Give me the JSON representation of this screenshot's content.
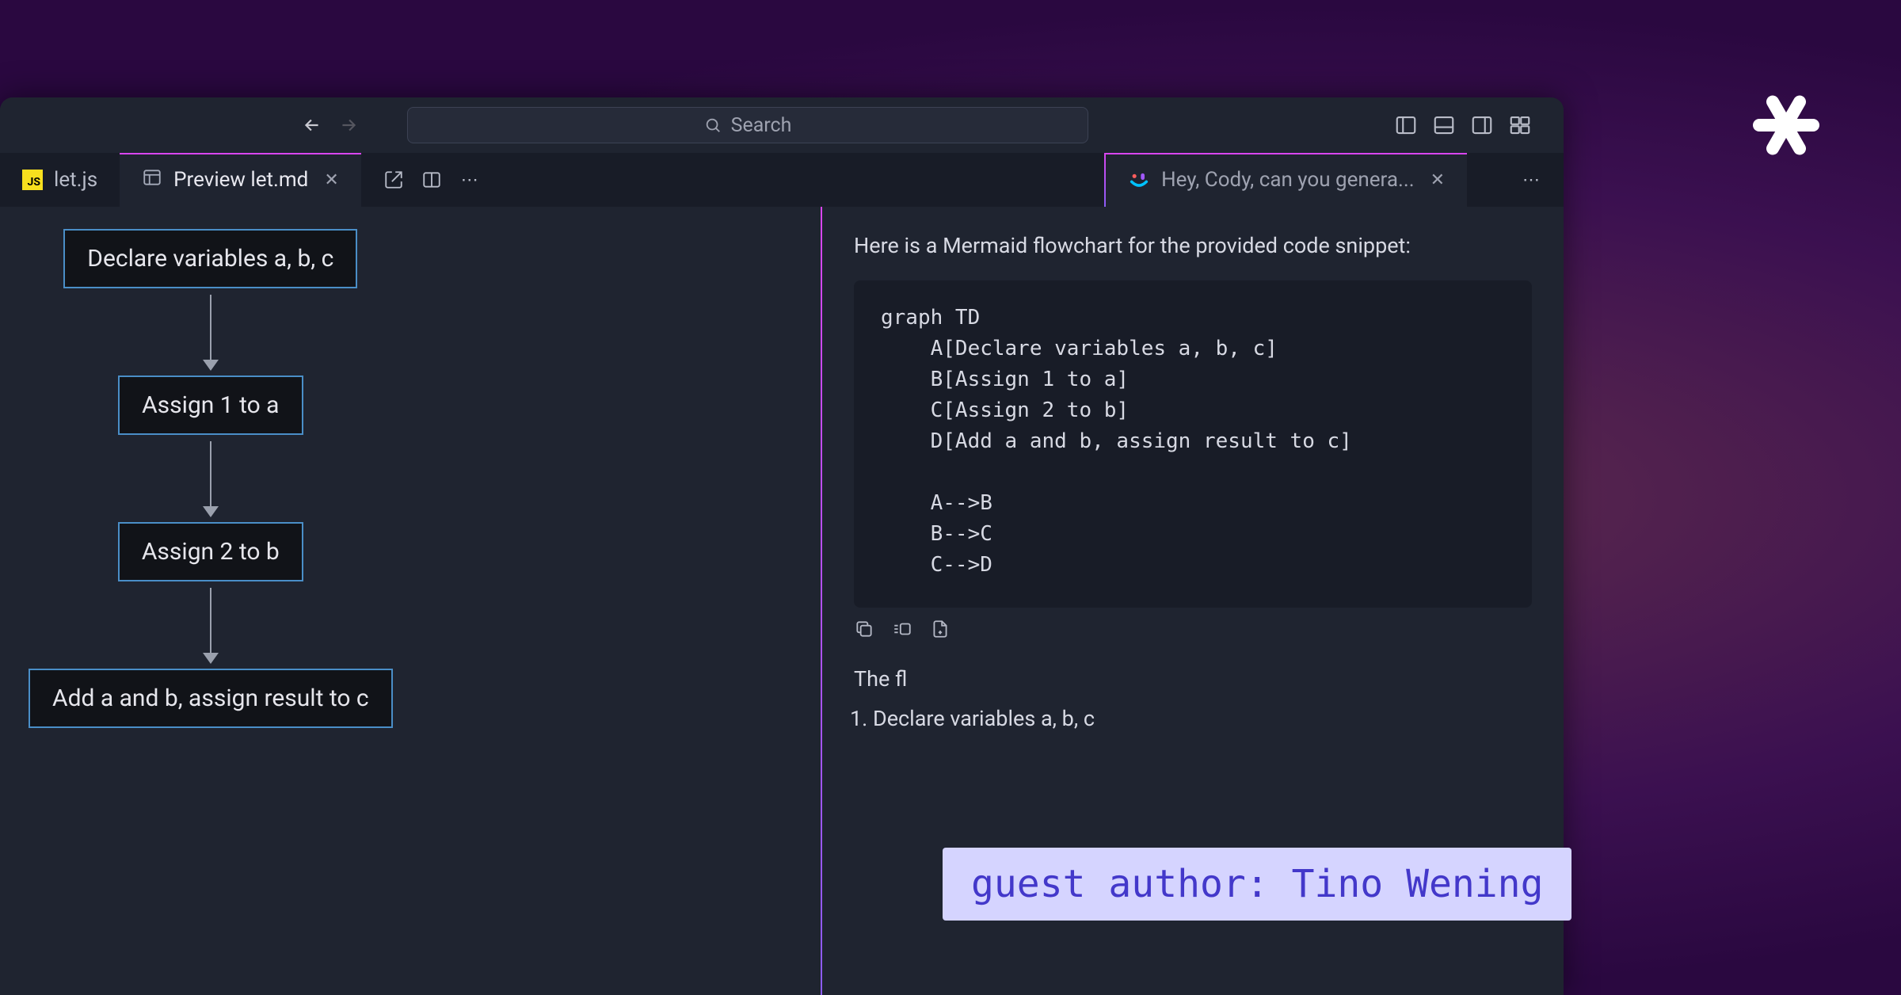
{
  "search": {
    "placeholder": "Search"
  },
  "tabs": {
    "left": [
      {
        "label": "let.js",
        "icon": "js",
        "active": false
      },
      {
        "label": "Preview let.md",
        "icon": "preview",
        "active": true,
        "closeable": true
      }
    ],
    "right": {
      "label": "Hey, Cody, can you genera...",
      "closeable": true
    }
  },
  "flowchart": {
    "nodes": [
      "Declare variables a, b, c",
      "Assign 1 to a",
      "Assign 2 to b",
      "Add a and b, assign result to c"
    ]
  },
  "chat": {
    "intro": "Here is a Mermaid flowchart for the provided code snippet:",
    "code": "graph TD\n    A[Declare variables a, b, c]\n    B[Assign 1 to a]\n    C[Assign 2 to b]\n    D[Add a and b, assign result to c]\n\n    A-->B\n    B-->C\n    C-->D",
    "follow": "The fl",
    "list": [
      "Declare variables a, b, c"
    ]
  },
  "guest_badge": "guest author: Tino Wening"
}
